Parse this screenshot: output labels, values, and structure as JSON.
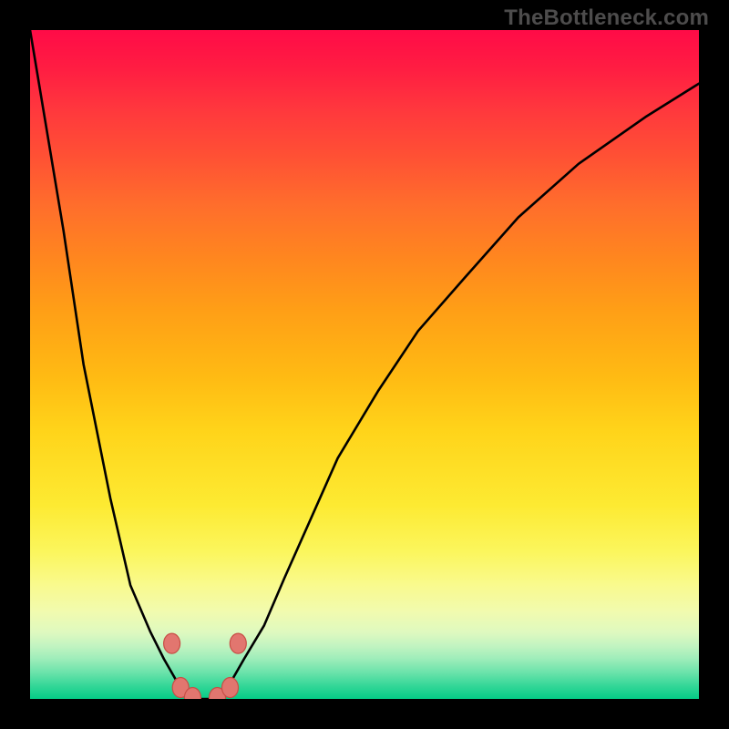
{
  "attribution": "TheBottleneck.com",
  "colors": {
    "black": "#000000",
    "curve": "#000000",
    "dot_fill": "#e2766f",
    "dot_stroke": "#c84e46",
    "gradient_top": "#ff0b47",
    "gradient_bottom": "#04cc86"
  },
  "chart_data": {
    "type": "line",
    "title": "",
    "xlabel": "",
    "ylabel": "",
    "x": [
      0.0,
      0.05,
      0.08,
      0.12,
      0.15,
      0.18,
      0.2,
      0.22,
      0.24,
      0.26,
      0.28,
      0.3,
      0.32,
      0.35,
      0.38,
      0.42,
      0.46,
      0.52,
      0.58,
      0.65,
      0.73,
      0.82,
      0.92,
      1.0
    ],
    "values": [
      1.0,
      0.7,
      0.5,
      0.3,
      0.17,
      0.1,
      0.06,
      0.025,
      0.0,
      0.0,
      0.0,
      0.025,
      0.06,
      0.11,
      0.18,
      0.27,
      0.36,
      0.46,
      0.55,
      0.63,
      0.72,
      0.8,
      0.87,
      0.92
    ],
    "xlim": [
      0,
      1
    ],
    "ylim": [
      0,
      1
    ],
    "dots": [
      {
        "x": 0.212,
        "y": 0.083
      },
      {
        "x": 0.225,
        "y": 0.017
      },
      {
        "x": 0.243,
        "y": 0.002
      },
      {
        "x": 0.28,
        "y": 0.002
      },
      {
        "x": 0.299,
        "y": 0.017
      },
      {
        "x": 0.311,
        "y": 0.083
      }
    ],
    "grid": false,
    "legend": false
  }
}
